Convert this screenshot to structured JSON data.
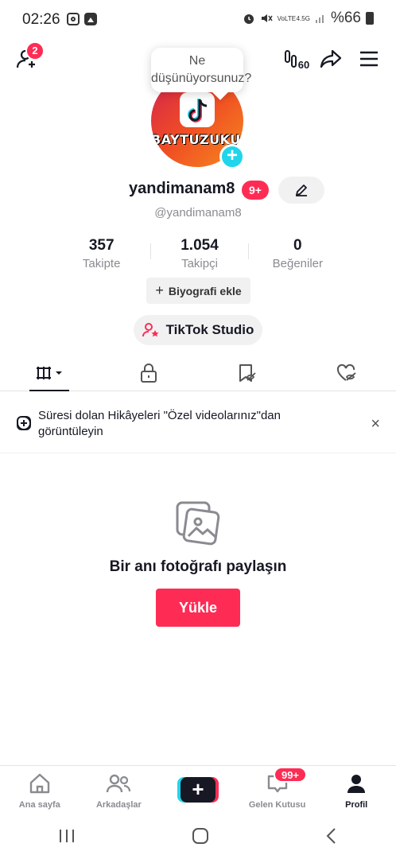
{
  "status_bar": {
    "time": "02:26",
    "battery": "%66",
    "network": "4.5G",
    "volte": "VoLTE"
  },
  "header": {
    "friend_requests_badge": "2",
    "tooltip": "Ne düşünüyorsunuz?",
    "recent_count": "60"
  },
  "profile": {
    "avatar_text": "BAYTUZUKURU",
    "username": "yandimanam8",
    "username_badge": "9+",
    "handle": "@yandimanam8",
    "stats": [
      {
        "value": "357",
        "label": "Takipte"
      },
      {
        "value": "1.054",
        "label": "Takipçi"
      },
      {
        "value": "0",
        "label": "Beğeniler"
      }
    ],
    "bio_button": "Biyografi ekle",
    "studio_button": "TikTok Studio"
  },
  "tabs": [
    "videos-grid",
    "private",
    "favorites",
    "liked"
  ],
  "notice": {
    "text": "Süresi dolan Hikâyeleri \"Özel videolarınız\"dan görüntüleyin",
    "close": "×"
  },
  "empty_state": {
    "title": "Bir anı fotoğrafı paylaşın",
    "button": "Yükle"
  },
  "bottom_nav": {
    "items": [
      {
        "label": "Ana sayfa",
        "icon": "home-icon"
      },
      {
        "label": "Arkadaşlar",
        "icon": "friends-icon"
      },
      {
        "label": "",
        "icon": "create-icon"
      },
      {
        "label": "Gelen Kutusu",
        "icon": "inbox-icon"
      },
      {
        "label": "Profil",
        "icon": "profile-icon"
      }
    ],
    "inbox_badge": "99+"
  },
  "colors": {
    "accent": "#fe2c55",
    "cyan": "#20d5ec",
    "text": "#161823",
    "muted": "#8a8b91"
  }
}
